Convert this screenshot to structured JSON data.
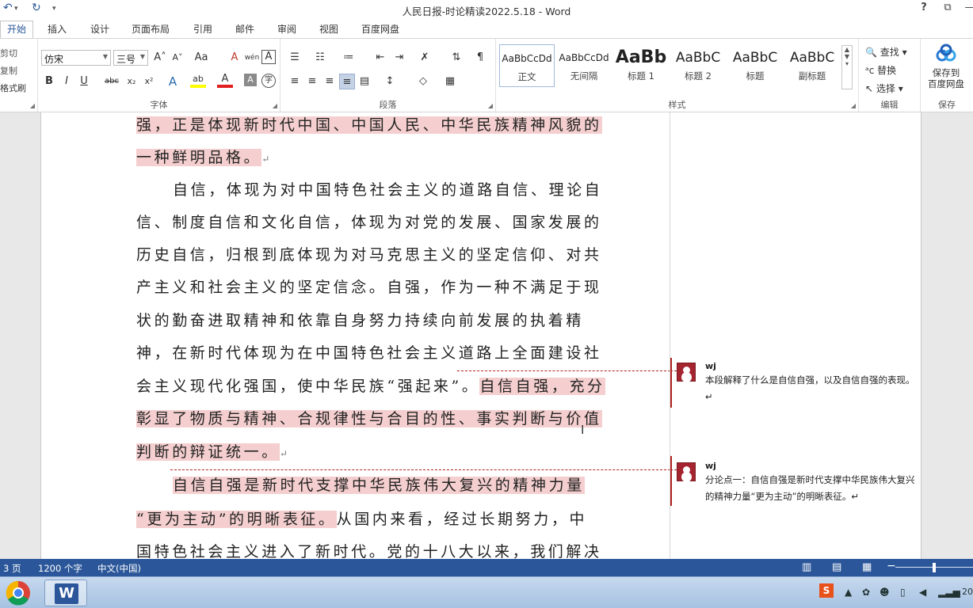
{
  "window": {
    "title": "人民日报-时论精读2022.5.18 - Word",
    "help": "?",
    "restore": "⧉",
    "minimize": "—"
  },
  "quick_access": {
    "undo": "↶",
    "redo": "↻",
    "customize": "▾"
  },
  "tabs": [
    "开始",
    "插入",
    "设计",
    "页面布局",
    "引用",
    "邮件",
    "审阅",
    "视图",
    "百度网盘"
  ],
  "ribbon": {
    "clipboard": {
      "cut": "剪切",
      "copy": "复制",
      "format_painter": "格式刷"
    },
    "font": {
      "label": "字体",
      "font_name": "仿宋",
      "font_size": "三号",
      "grow": "A˄",
      "shrink": "A˅",
      "case": "Aa",
      "clear": "A",
      "pinyin": "wén",
      "border_char": "A",
      "bold": "B",
      "italic": "I",
      "underline": "U",
      "strike": "abc",
      "subscript": "x₂",
      "superscript": "x²",
      "text_effect": "A",
      "highlight": "ab",
      "font_color": "A",
      "shading": "A",
      "enclose": "字"
    },
    "paragraph": {
      "label": "段落"
    },
    "styles": {
      "label": "样式",
      "items": [
        {
          "sample": "AaBbCcDd",
          "name": "正文"
        },
        {
          "sample": "AaBbCcDd",
          "name": "无间隔"
        },
        {
          "sample": "AaBb",
          "name": "标题 1"
        },
        {
          "sample": "AaBbC",
          "name": "标题 2"
        },
        {
          "sample": "AaBbC",
          "name": "标题"
        },
        {
          "sample": "AaBbC",
          "name": "副标题"
        }
      ]
    },
    "editing": {
      "label": "编辑",
      "find": "查找",
      "replace": "替换",
      "select": "选择"
    },
    "save": {
      "label": "保存",
      "button": "保存到\n百度网盘"
    }
  },
  "document": {
    "lines": [
      {
        "text": "强，正是体现新时代中国、中国人民、中华民族精神风貌的",
        "hl": "full"
      },
      {
        "text": "一种鲜明品格。",
        "hl": "full",
        "mark": "↵"
      },
      {
        "text": "自信，体现为对中国特色社会主义的道路自信、理论自",
        "indent": true
      },
      {
        "text": "信、制度自信和文化自信，体现为对党的发展、国家发展的"
      },
      {
        "text": "历史自信，归根到底体现为对马克思主义的坚定信仰、对共"
      },
      {
        "text": "产主义和社会主义的坚定信念。自强，作为一种不满足于现"
      },
      {
        "text": "状的勤奋进取精神和依靠自身努力持续向前发展的执着精"
      },
      {
        "text": "神，在新时代体现为在中国特色社会主义道路上全面建设社"
      },
      {
        "text": "会主义现代化强国，使中华民族“强起来”。",
        "hl_tail": "自信自强，充分"
      },
      {
        "text": "彰显了物质与精神、合规律性与合目的性、事实判断与价值",
        "hl": "full"
      },
      {
        "text": "判断的辩证统一。",
        "hl": "full",
        "mark": "↵"
      },
      {
        "text": "自信自强是新时代支撑中华民族伟大复兴的精神力量",
        "hl": "full",
        "indent": true
      },
      {
        "text": "“更为主动”的明晰表征。",
        "hl": "full",
        "tail": "从国内来看，经过长期努力，中"
      },
      {
        "text": "国特色社会主义进入了新时代。党的十八大以来，我们解决"
      }
    ]
  },
  "comments": [
    {
      "author": "wj",
      "text": "本段解释了什么是自信自强，以及自信自强的表现。↵"
    },
    {
      "author": "wj",
      "text": "分论点一：自信自强是新时代支撑中华民族伟大复兴的精神力量“更为主动”的明晰表征。↵"
    }
  ],
  "status": {
    "page": "3 页",
    "words": "1200 个字",
    "language": "中文(中国)",
    "zoom_right": "20"
  },
  "colors": {
    "accent": "#2b579a",
    "highlight": "#f5cfcf",
    "comment": "#b22222"
  }
}
